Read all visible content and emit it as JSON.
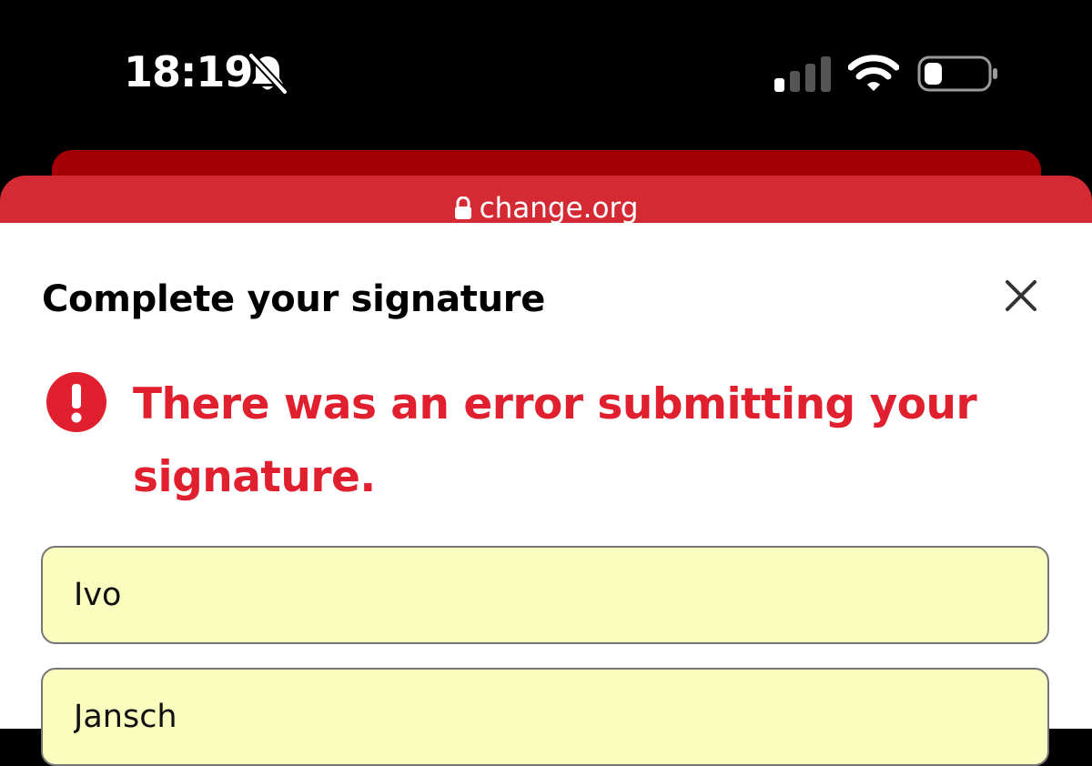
{
  "status_bar": {
    "time": "18:19",
    "icons": [
      "bell-slash-icon",
      "cellular-signal-icon",
      "wifi-icon",
      "battery-icon"
    ]
  },
  "browser": {
    "url": "change.org",
    "colors": {
      "tab_back": "#a30008",
      "tab_front": "#d42a33"
    }
  },
  "dialog": {
    "title": "Complete your signature",
    "error_message": "There was an error submitting your signature.",
    "error_color": "#e0202f",
    "fields": [
      {
        "value": "Ivo"
      },
      {
        "value": "Jansch"
      }
    ],
    "field_background": "#f9fdbe"
  }
}
